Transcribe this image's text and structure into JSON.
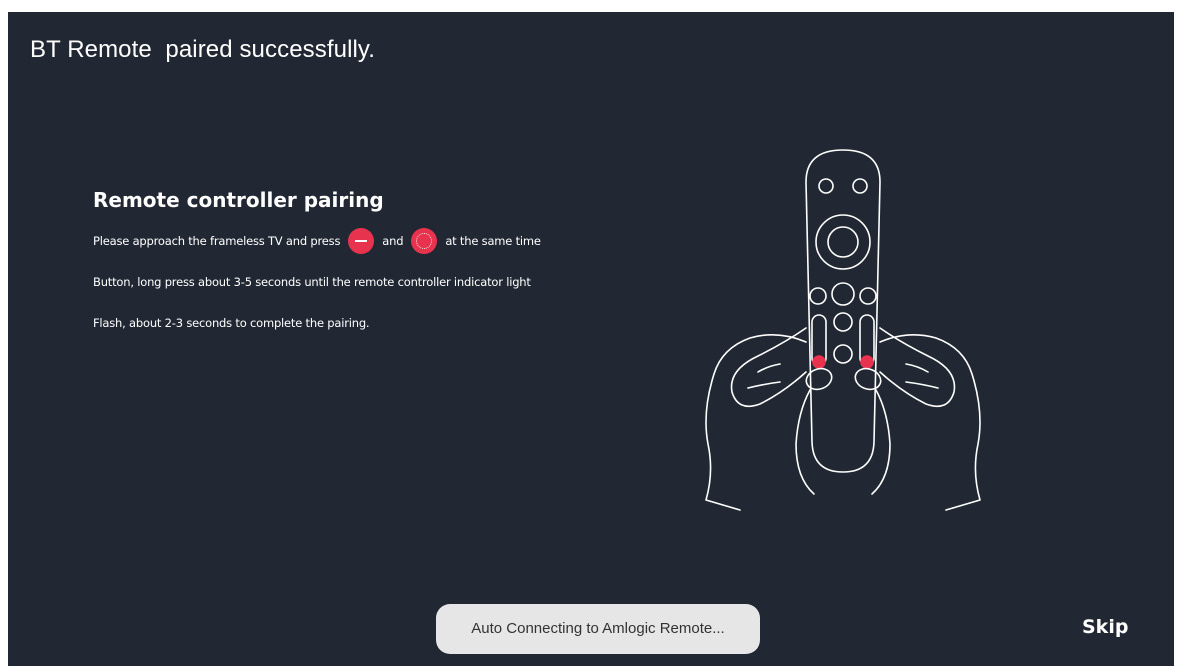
{
  "colors": {
    "screen_background": "#222833",
    "accent_red": "#e8334f",
    "text": "#ffffff",
    "toast_background": "#e6e6e6",
    "toast_text": "#333333"
  },
  "header": {
    "status_message": "BT Remote  paired successfully."
  },
  "pairing": {
    "heading": "Remote controller pairing",
    "line1": {
      "before_first_button": "Please approach the frameless TV and press",
      "first_button_icon": "minus-button-icon",
      "between_buttons": "and",
      "second_button_icon": "dpad-button-icon",
      "after_second_button": "at the same time"
    },
    "line2": "Button, long press about 3-5 seconds until the remote controller indicator light",
    "line3": "Flash, about 2-3 seconds to complete the pairing."
  },
  "illustration": {
    "icon": "hands-holding-remote-icon"
  },
  "toast": {
    "message": "Auto Connecting to Amlogic Remote..."
  },
  "actions": {
    "skip_label": "Skip"
  }
}
